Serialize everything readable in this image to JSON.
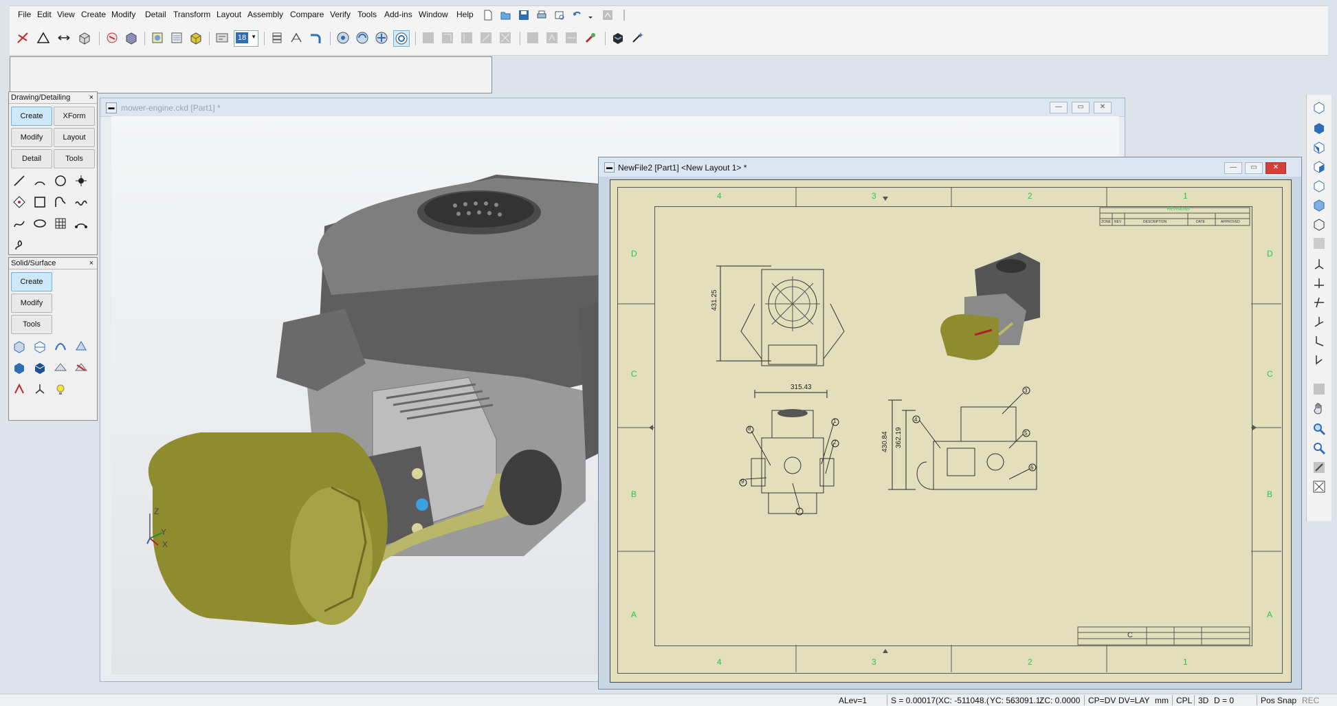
{
  "menu": [
    "File",
    "Edit",
    "View",
    "Create",
    "Modify",
    "Detail",
    "Transform",
    "Layout",
    "Assembly",
    "Compare",
    "Verify",
    "Tools",
    "Add-ins",
    "Window",
    "Help"
  ],
  "toolbar": {
    "layer_value": "18"
  },
  "palettes": {
    "drawing_detailing": {
      "title": "Drawing/Detailing",
      "close": "×",
      "buttons": [
        "Create",
        "XForm",
        "Modify",
        "Layout",
        "Detail",
        "Tools"
      ]
    },
    "solid_surface": {
      "title": "Solid/Surface",
      "close": "×",
      "buttons": [
        "Create",
        "Modify",
        "Tools"
      ]
    }
  },
  "window_3d": {
    "title": "mower-engine.ckd [Part1] *",
    "axes": {
      "z": "Z",
      "y": "Y",
      "x": "X"
    }
  },
  "window_layout": {
    "title": "NewFile2 [Part1] <New Layout 1> *",
    "border_columns": [
      "4",
      "3",
      "2",
      "1"
    ],
    "border_rows": [
      "D",
      "C",
      "B",
      "A"
    ],
    "dimensions": [
      "431.25",
      "315.43",
      "430.84",
      "362.19"
    ],
    "balloons": [
      "1",
      "2",
      "3",
      "4",
      "5",
      "6",
      "7",
      "8",
      "9"
    ],
    "revision_header": "REVISIONS",
    "revision_cols": [
      "ZONE",
      "REV",
      "DESCRIPTION",
      "DATE",
      "APPROVED"
    ],
    "title_block_letter": "C"
  },
  "status": {
    "alev": "ALev=1",
    "scale": "S = 0.00017(",
    "xc": "XC: -511048.(",
    "yc": "YC: 563091.1:",
    "zc": "ZC: 0.0000",
    "cp": "CP=DV",
    "dv": "DV=LAY",
    "unit": "mm",
    "cpl": "CPL",
    "mode3d": "3D",
    "depth": "D = 0",
    "possnap": "Pos Snap",
    "rec": "REC"
  },
  "colors": {
    "paper": "#e3dfbd",
    "border_green": "#22c74a",
    "engine_grey": "#6d6d6d",
    "muffler": "#8e8c2f",
    "accent_blue": "#3aa0e0"
  }
}
